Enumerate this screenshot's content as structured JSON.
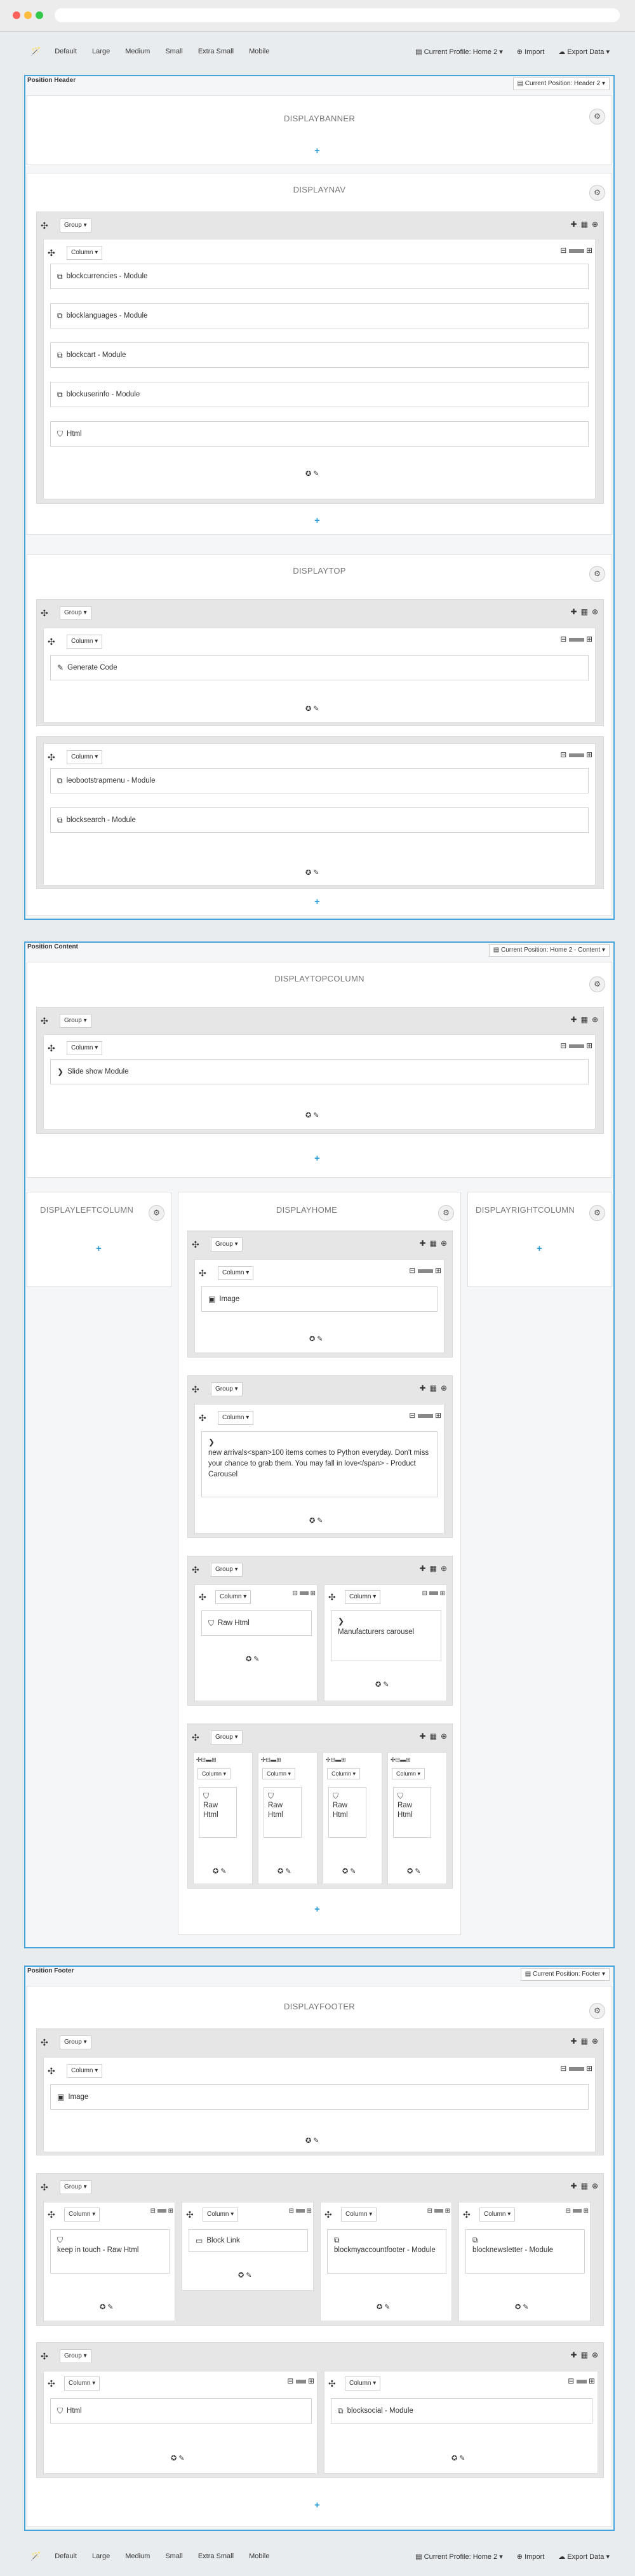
{
  "toolbar": {
    "devices": [
      "Default",
      "Large",
      "Medium",
      "Small",
      "Extra Small",
      "Mobile"
    ],
    "profile": "Current Profile: Home 2",
    "import": "Import",
    "export": "Export Data"
  },
  "common": {
    "group": "Group",
    "column": "Column",
    "plus": "+",
    "gear": "⚙",
    "move": "✣",
    "edit": "✪ ✎"
  },
  "header": {
    "title": "Position Header",
    "current": "Current Position: Header 2",
    "banner": "DISPLAYBANNER",
    "nav": {
      "title": "DISPLAYNAV",
      "modules": [
        "blockcurrencies - Module",
        "blocklanguages - Module",
        "blockcart - Module",
        "blockuserinfo - Module",
        "Html"
      ]
    },
    "top": {
      "title": "DISPLAYTOP",
      "g1": [
        "Generate Code"
      ],
      "g2": [
        "leobootstrapmenu - Module",
        "blocksearch - Module"
      ]
    }
  },
  "content": {
    "title": "Position Content",
    "current": "Current Position: Home 2 - Content",
    "topcolumn": {
      "title": "DISPLAYTOPCOLUMN",
      "module": "Slide show Module"
    },
    "left": "DISPLAYLEFTCOLUMN",
    "right": "DISPLAYRIGHTCOLUMN",
    "home": {
      "title": "DISPLAYHOME",
      "image": "Image",
      "product": "new arrivals<span>100 items comes to Python everyday. Don't miss your chance to grab them. You may fall in love</span> - Product Carousel",
      "rawhtml": "Raw Html",
      "manufacturers": "Manufacturers carousel",
      "raw2": "Raw Html"
    }
  },
  "footer": {
    "title": "Position Footer",
    "current": "Current Position: Footer",
    "hook": "DISPLAYFOOTER",
    "image": "Image",
    "mods": [
      "keep in touch - Raw Html",
      "Block Link",
      "blockmyaccountfooter - Module",
      "blocknewsletter - Module"
    ],
    "g3": [
      "Html",
      "blocksocial - Module"
    ]
  }
}
